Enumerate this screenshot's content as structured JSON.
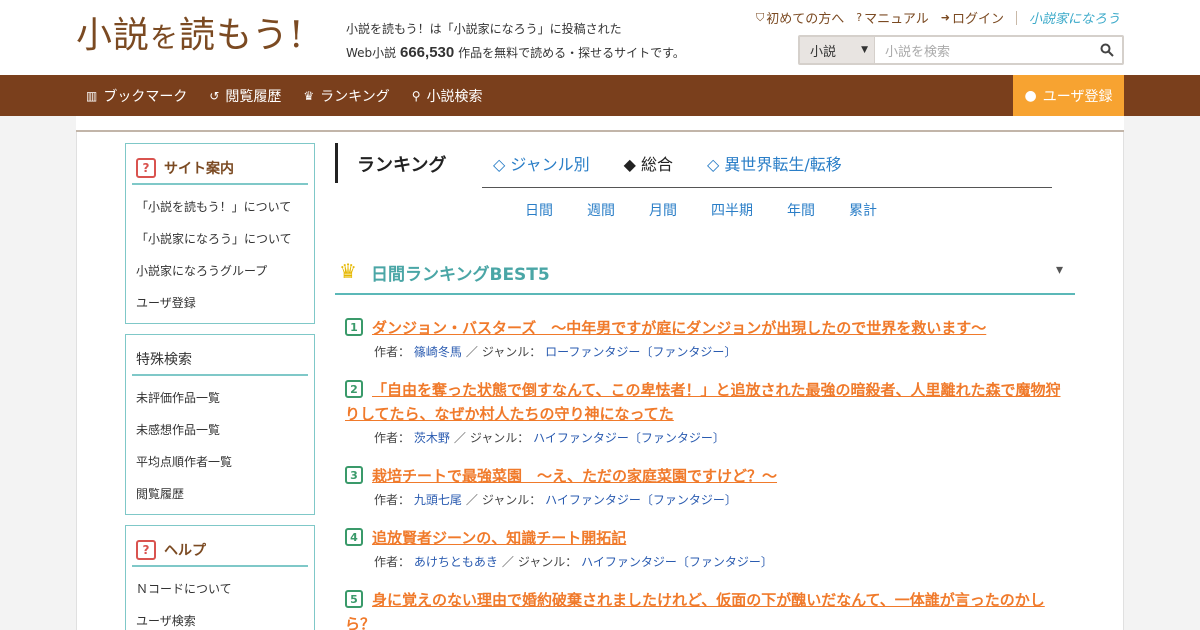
{
  "header": {
    "logo_main": "小説",
    "logo_small": "を",
    "logo_rest": "読もう!",
    "tagline_line1": "小説を読もう！は「小説家になろう」に投稿された",
    "tagline_prefix": "Web小説",
    "tagline_count": "666,530",
    "tagline_suffix": "作品を無料で読める・探せるサイトです。",
    "links": {
      "beginners": "初めての方へ",
      "manual": "マニュアル",
      "login": "ログイン",
      "narou": "小説家になろう"
    },
    "search": {
      "select_value": "小説",
      "placeholder": "小説を検索"
    }
  },
  "nav": {
    "items": [
      {
        "label": "ブックマーク",
        "icon": "books-icon"
      },
      {
        "label": "閲覧履歴",
        "icon": "history-icon"
      },
      {
        "label": "ランキング",
        "icon": "crown-icon"
      },
      {
        "label": "小説検索",
        "icon": "search-icon"
      }
    ],
    "register": "ユーザ登録"
  },
  "sidebar": {
    "site_guide": {
      "title": "サイト案内",
      "items": [
        "「小説を読もう！」について",
        "「小説家になろう」について",
        "小説家になろうグループ",
        "ユーザ登録"
      ]
    },
    "special_search": {
      "title": "特殊検索",
      "items": [
        "未評価作品一覧",
        "未感想作品一覧",
        "平均点順作者一覧",
        "閲覧履歴"
      ]
    },
    "help": {
      "title": "ヘルプ",
      "items": [
        "Ｎコードについて",
        "ユーザ検索"
      ]
    }
  },
  "ranking": {
    "title": "ランキング",
    "tabs": [
      "◇ ジャンル別",
      "◆ 総合",
      "◇ 異世界転生/転移"
    ],
    "periods": [
      "日間",
      "週間",
      "月間",
      "四半期",
      "年間",
      "累計"
    ],
    "best_title": "日間ランキングBEST5",
    "author_label": "作者：",
    "genre_label": "ジャンル：",
    "entries": [
      {
        "rank": "1",
        "title": "ダンジョン・バスターズ　～中年男ですが庭にダンジョンが出現したので世界を救います～",
        "author": "篠崎冬馬",
        "genre": "ローファンタジー〔ファンタジー〕"
      },
      {
        "rank": "2",
        "title": "「自由を奪った状態で倒すなんて、この卑怯者！」と追放された最強の暗殺者、人里離れた森で魔物狩りしてたら、なぜか村人たちの守り神になってた",
        "author": "茨木野",
        "genre": "ハイファンタジー〔ファンタジー〕"
      },
      {
        "rank": "3",
        "title": "栽培チートで最強菜園　～え、ただの家庭菜園ですけど？～",
        "author": "九頭七尾",
        "genre": "ハイファンタジー〔ファンタジー〕"
      },
      {
        "rank": "4",
        "title": "追放賢者ジーンの、知識チート開拓記",
        "author": "あけちともあき",
        "genre": "ハイファンタジー〔ファンタジー〕"
      },
      {
        "rank": "5",
        "title": "身に覚えのない理由で婚約破棄されましたけれど、仮面の下が醜いだなんて、一体誰が言ったのかしら？",
        "author": "",
        "genre": ""
      }
    ]
  }
}
